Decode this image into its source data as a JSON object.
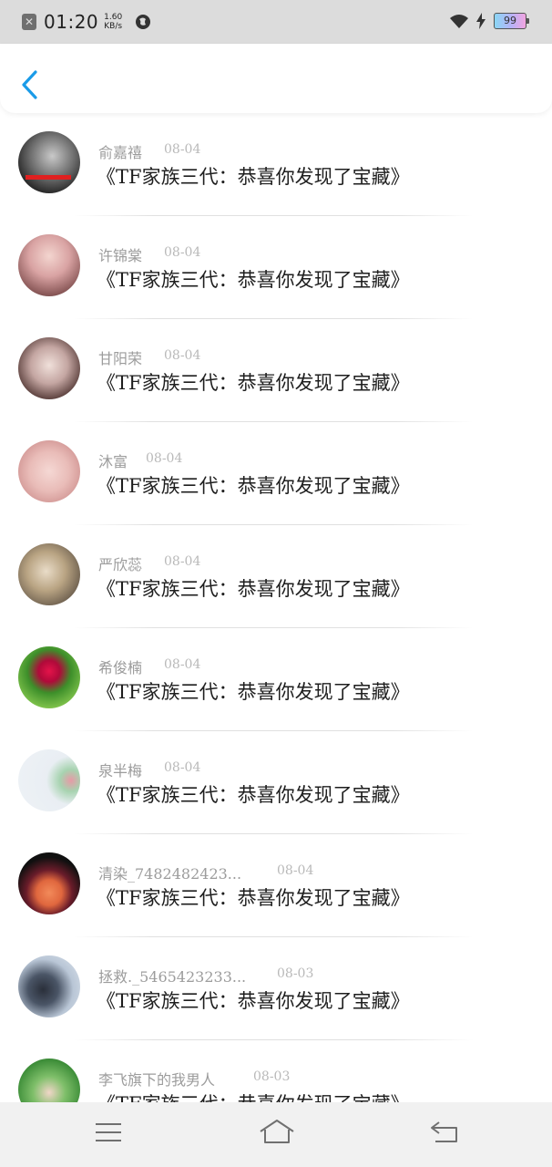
{
  "status_bar": {
    "time": "01:20",
    "speed_value": "1.60",
    "speed_unit": "KB/s",
    "battery": "99",
    "icons": [
      "close-notification-icon",
      "globe-icon",
      "wifi-icon",
      "charging-icon",
      "battery-icon"
    ]
  },
  "header": {
    "back_icon": "chevron-left-icon",
    "accent": "#1a9be8"
  },
  "comments": [
    {
      "name": "俞嘉禧",
      "date": "08-04",
      "title": "《TF家族三代：恭喜你发现了宝藏》"
    },
    {
      "name": "许锦棠",
      "date": "08-04",
      "title": "《TF家族三代：恭喜你发现了宝藏》"
    },
    {
      "name": "甘阳荣",
      "date": "08-04",
      "title": "《TF家族三代：恭喜你发现了宝藏》"
    },
    {
      "name": "沐富",
      "date": "08-04",
      "title": "《TF家族三代：恭喜你发现了宝藏》"
    },
    {
      "name": "严欣蕊",
      "date": "08-04",
      "title": "《TF家族三代：恭喜你发现了宝藏》"
    },
    {
      "name": "希俊楠",
      "date": "08-04",
      "title": "《TF家族三代：恭喜你发现了宝藏》"
    },
    {
      "name": "泉半梅",
      "date": "08-04",
      "title": "《TF家族三代：恭喜你发现了宝藏》"
    },
    {
      "name": "清染_7482482423...",
      "date": "08-04",
      "title": "《TF家族三代：恭喜你发现了宝藏》"
    },
    {
      "name": "拯救._5465423233...",
      "date": "08-03",
      "title": "《TF家族三代：恭喜你发现了宝藏》"
    },
    {
      "name": "李飞旗下的我男人",
      "date": "08-03",
      "title": "《TF家族三代：恭喜你发现了宝藏》"
    }
  ],
  "nav_bar": {
    "icons": [
      "menu-icon",
      "home-icon",
      "back-icon"
    ]
  }
}
